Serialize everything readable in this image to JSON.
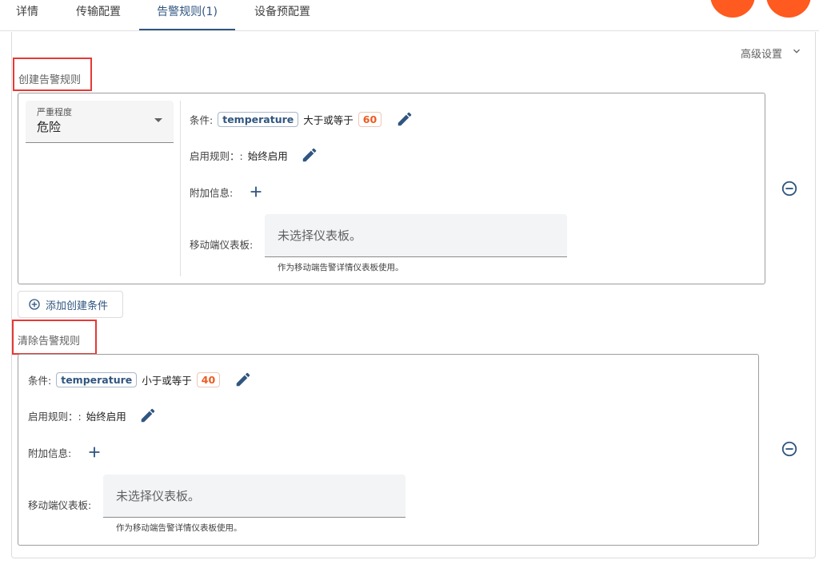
{
  "tabs": [
    {
      "label": "详情",
      "active": false
    },
    {
      "label": "传输配置",
      "active": false
    },
    {
      "label": "告警规则(1)",
      "active": true
    },
    {
      "label": "设备预配置",
      "active": false
    }
  ],
  "advanced": {
    "label": "高级设置"
  },
  "create_rules": {
    "section_label": "创建告警规则",
    "severity": {
      "label": "严重程度",
      "value": "危险"
    },
    "condition": {
      "label": "条件:",
      "key": "temperature",
      "operator": "大于或等于",
      "value": "60"
    },
    "schedule": {
      "label": "启用规则：:",
      "value": "始终启用"
    },
    "additional_info": {
      "label": "附加信息:"
    },
    "dashboard": {
      "label": "移动端仪表板:",
      "placeholder": "未选择仪表板。",
      "hint": "作为移动端告警详情仪表板使用。"
    },
    "add_button": "添加创建条件"
  },
  "clear_rule": {
    "section_label": "清除告警规则",
    "condition": {
      "label": "条件:",
      "key": "temperature",
      "operator": "小于或等于",
      "value": "40"
    },
    "schedule": {
      "label": "启用规则：:",
      "value": "始终启用"
    },
    "additional_info": {
      "label": "附加信息:"
    },
    "dashboard": {
      "label": "移动端仪表板:",
      "placeholder": "未选择仪表板。",
      "hint": "作为移动端告警详情仪表板使用。"
    }
  },
  "colors": {
    "accent": "#305680",
    "value_orange": "#ef5a20",
    "fab_orange": "#ff5a1f",
    "highlight_red": "#e53935"
  }
}
